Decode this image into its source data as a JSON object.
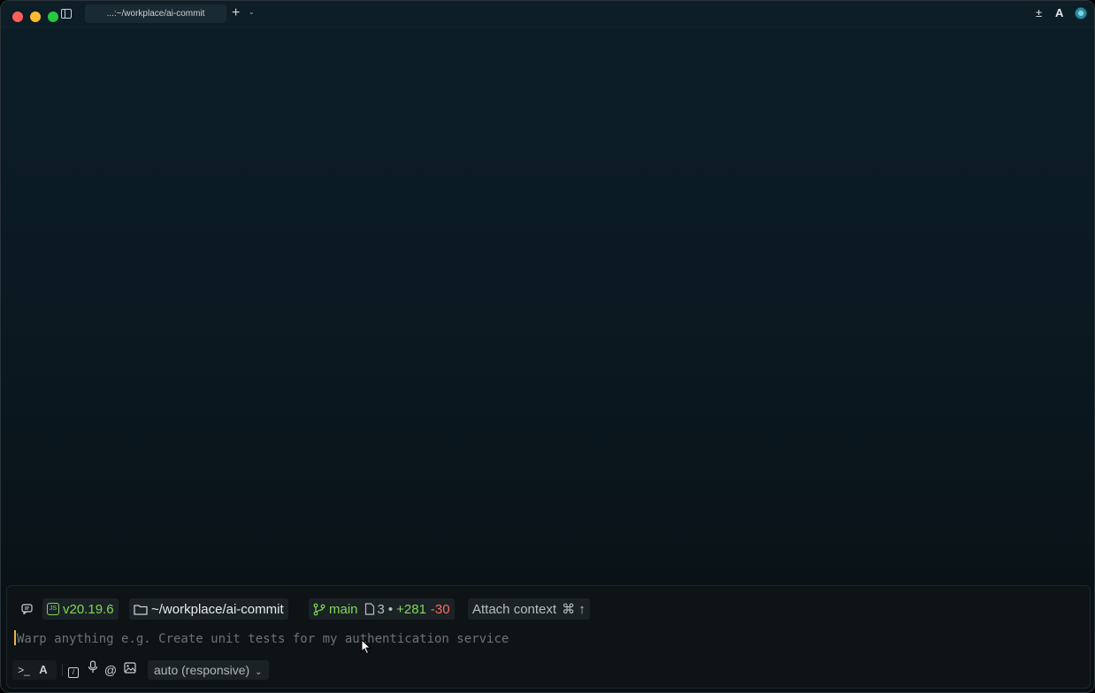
{
  "titlebar": {
    "tab_title": "...:~/workplace/ai-commit",
    "new_tab_glyph": "+",
    "dropdown_glyph": "⌄",
    "right_icons": [
      "plus-minus-icon",
      "agent-icon",
      "avatar-icon"
    ],
    "plusminus_glyph": "±",
    "agent_glyph": "A"
  },
  "context": {
    "node_version": "v20.19.6",
    "directory": "~/workplace/ai-commit",
    "git_branch": "main",
    "files_changed": "3",
    "bullet": "•",
    "additions": "+281",
    "deletions": "-30",
    "attach_label": "Attach context",
    "attach_shortcut": "⌘ ↑"
  },
  "prompt": {
    "placeholder": "Warp anything e.g. Create unit tests for my authentication service"
  },
  "toolbar": {
    "terminal_glyph": ">_",
    "agent_glyph": "A",
    "slash_glyph": "/",
    "at_glyph": "@",
    "model_value": "auto (responsive)",
    "chevron_glyph": "⌄"
  },
  "colors": {
    "traffic_red": "#fe5f57",
    "traffic_yellow": "#febc2e",
    "traffic_green": "#28c840",
    "accent_green": "#7ed957",
    "deletion_red": "#ff6b5b",
    "caret": "#e8b64a"
  }
}
